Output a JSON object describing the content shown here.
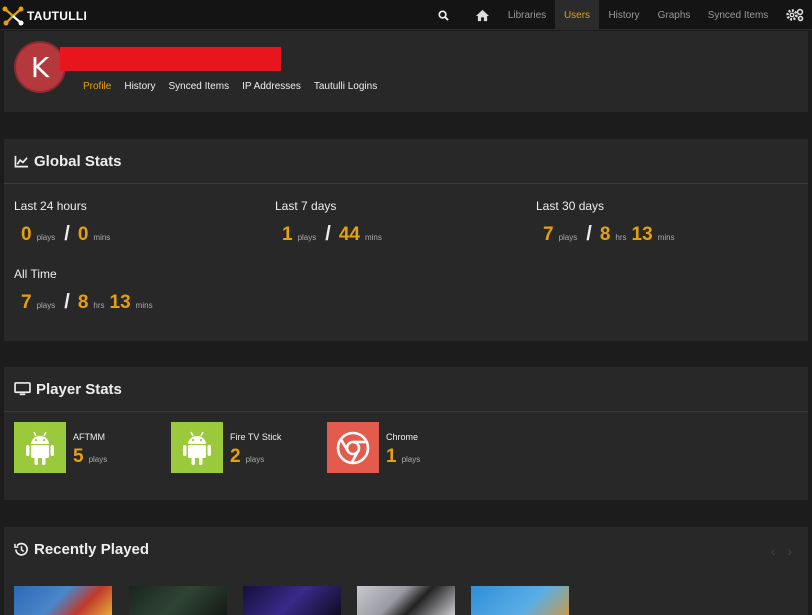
{
  "nav": {
    "brand": "TAUTULLI",
    "items": [
      {
        "label": "Libraries"
      },
      {
        "label": "Users"
      },
      {
        "label": "History"
      },
      {
        "label": "Graphs"
      },
      {
        "label": "Synced Items"
      }
    ],
    "active": "Users"
  },
  "profile": {
    "avatar_letter": "K",
    "tabs": [
      "Profile",
      "History",
      "Synced Items",
      "IP Addresses",
      "Tautulli Logins"
    ],
    "active_tab": "Profile"
  },
  "global_stats": {
    "title": "Global Stats",
    "periods": [
      {
        "label": "Last 24 hours",
        "plays": "0",
        "plays_unit": "plays",
        "mins": "0",
        "mins_unit": "mins"
      },
      {
        "label": "Last 7 days",
        "plays": "1",
        "plays_unit": "plays",
        "mins": "44",
        "mins_unit": "mins"
      },
      {
        "label": "Last 30 days",
        "plays": "7",
        "plays_unit": "plays",
        "hrs": "8",
        "hrs_unit": "hrs",
        "mins": "13",
        "mins_unit": "mins"
      },
      {
        "label": "All Time",
        "plays": "7",
        "plays_unit": "plays",
        "hrs": "8",
        "hrs_unit": "hrs",
        "mins": "13",
        "mins_unit": "mins"
      }
    ]
  },
  "player_stats": {
    "title": "Player Stats",
    "players": [
      {
        "name": "AFTMM",
        "count": "5",
        "unit": "plays",
        "icon": "android-icon",
        "color": "#9ac93b"
      },
      {
        "name": "Fire TV Stick",
        "count": "2",
        "unit": "plays",
        "icon": "android-icon",
        "color": "#9ac93b"
      },
      {
        "name": "Chrome",
        "count": "1",
        "unit": "plays",
        "icon": "chrome-icon",
        "color": "#e25b4d"
      }
    ]
  },
  "recently_played": {
    "title": "Recently Played",
    "thumbnail_colors": [
      "#3a6fb0",
      "#1f2a22",
      "#1c1840",
      "#b8b8c0",
      "#3a8fd0"
    ]
  },
  "colors": {
    "accent": "#e5a00d",
    "navbar_bg": "#141414",
    "panel_bg": "#282828",
    "page_bg": "#1c1c1c"
  }
}
